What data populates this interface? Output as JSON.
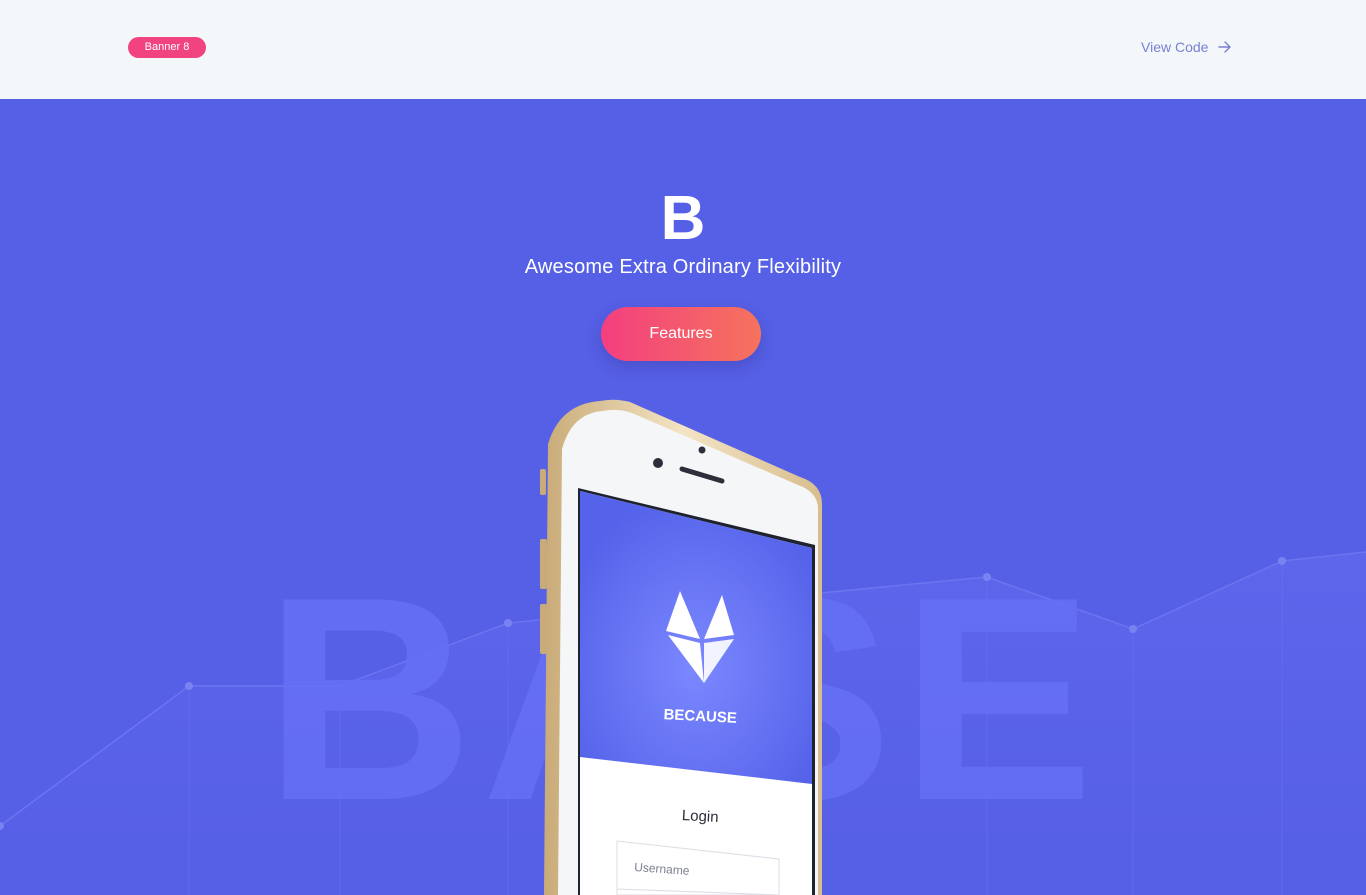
{
  "topbar": {
    "badge_label": "Banner 8",
    "view_code_label": "View Code"
  },
  "hero": {
    "logo_letter": "B",
    "tagline": "Awesome Extra Ordinary Flexibility",
    "features_label": "Features",
    "watermark_text": "BASE"
  },
  "phone": {
    "app_name": "BECAUSE",
    "login_title": "Login",
    "username_placeholder": "Username"
  },
  "colors": {
    "hero_bg": "#5660e6",
    "badge": "#f0437f",
    "button_gradient_start": "#f43f7f",
    "button_gradient_end": "#f5735d"
  }
}
